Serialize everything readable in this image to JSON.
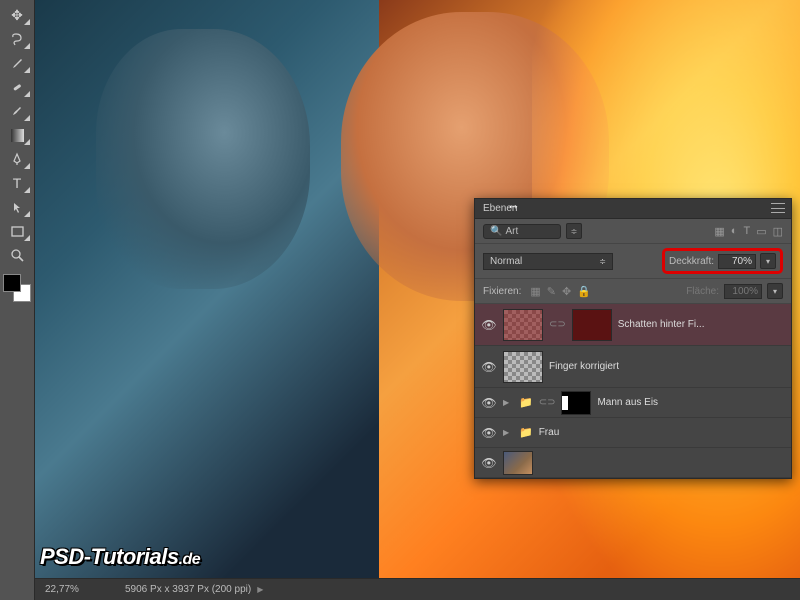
{
  "watermark": {
    "text": "PSD-Tutorials",
    "suffix": ".de"
  },
  "statusbar": {
    "zoom": "22,77%",
    "docinfo": "5906 Px x 3937 Px (200 ppi)"
  },
  "panel": {
    "title": "Ebenen",
    "search_label": "Art",
    "blend_mode": "Normal",
    "opacity_label": "Deckkraft:",
    "opacity_value": "70%",
    "lock_label": "Fixieren:",
    "fill_label": "Fläche:",
    "fill_value": "100%"
  },
  "layers": [
    {
      "name": "Schatten hinter Fi...",
      "selected": true,
      "linked": true
    },
    {
      "name": "Finger korrigiert"
    },
    {
      "name": "Mann aus Eis",
      "group": true,
      "masked": true
    },
    {
      "name": "Frau",
      "group": true
    },
    {
      "name": "…"
    }
  ],
  "tools": {
    "move": "move-tool",
    "marquee": "marquee-tool",
    "lasso": "lasso-tool",
    "wand": "magic-wand-tool",
    "crop": "crop-tool",
    "eyedropper": "eyedropper-tool",
    "heal": "healing-brush-tool",
    "brush": "brush-tool",
    "stamp": "clone-stamp-tool",
    "eraser": "eraser-tool",
    "gradient": "gradient-tool",
    "type": "type-tool",
    "path": "path-selection-tool",
    "rect": "rectangle-tool",
    "zoom": "zoom-tool"
  }
}
